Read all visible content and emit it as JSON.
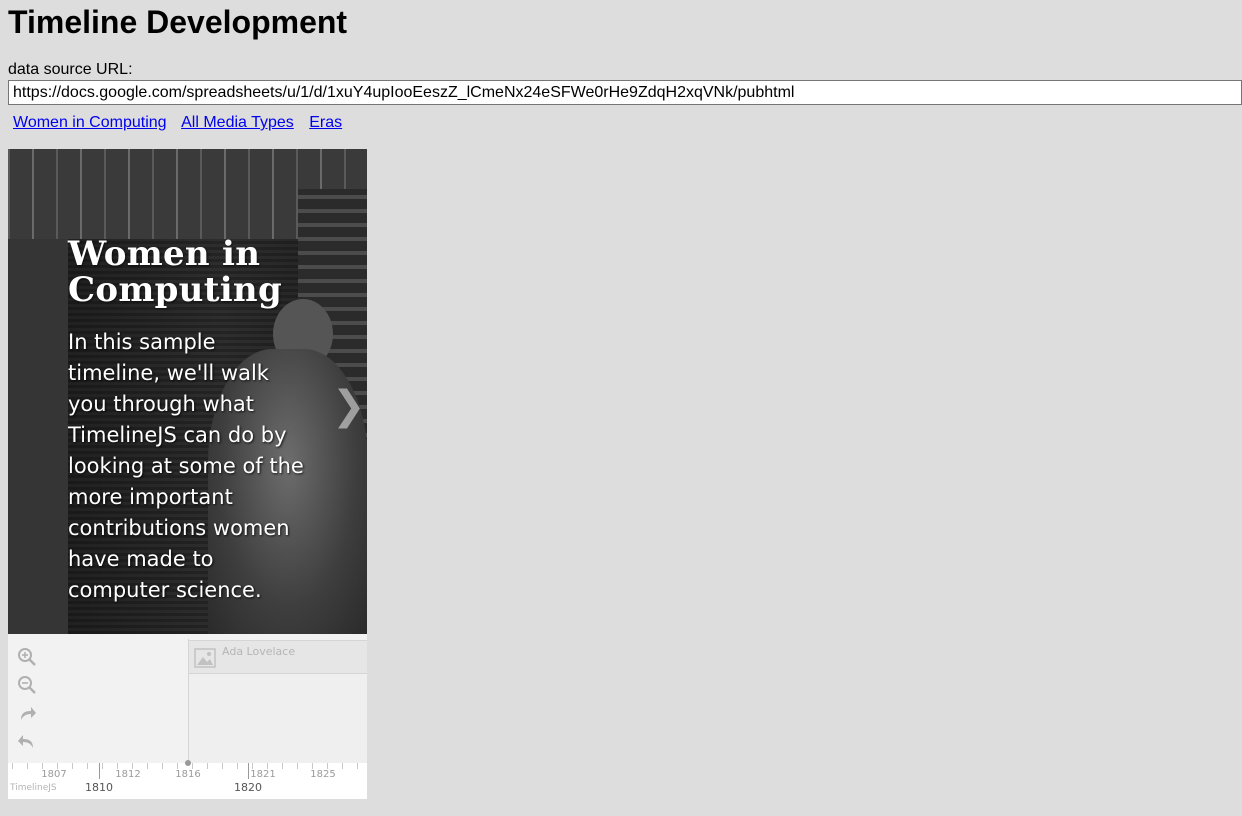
{
  "page": {
    "title": "Timeline Development",
    "url_label": "data source URL:",
    "url_value": "https://docs.google.com/spreadsheets/u/1/d/1xuY4upIooEeszZ_lCmeNx24eSFWe0rHe9ZdqH2xqVNk/pubhtml"
  },
  "links": [
    {
      "label": "Women in Computing"
    },
    {
      "label": "All Media Types"
    },
    {
      "label": "Eras"
    }
  ],
  "timeline": {
    "slide": {
      "title": "Women in Computing",
      "text": "In this sample timeline, we'll walk you through what TimelineJS can do by looking at some of the more important contributions women have made to computer science."
    },
    "next_glyph": "❯",
    "marker": {
      "label": "Ada Lovelace"
    },
    "axis": {
      "minor_labels": [
        "1807",
        "1812",
        "1816",
        "1821",
        "1825"
      ],
      "major_labels": [
        "1810",
        "1820"
      ]
    },
    "brand": "TimelineJS"
  }
}
